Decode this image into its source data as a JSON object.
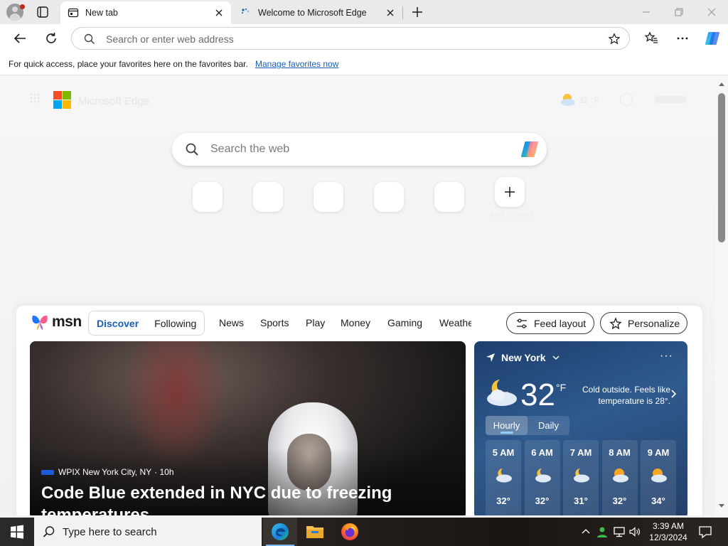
{
  "tabs": {
    "active": {
      "title": "New tab"
    },
    "inactive": {
      "title": "Welcome to Microsoft Edge"
    }
  },
  "addressbar": {
    "placeholder": "Search or enter web address",
    "value": ""
  },
  "favorites_bar": {
    "message": "For quick access, place your favorites here on the favorites bar.",
    "link": "Manage favorites now"
  },
  "ntp": {
    "search_placeholder": "Search the web",
    "brand_text": "Microsoft Edge",
    "weather_faded": "32 °F",
    "tiles_count": 6,
    "add_tile_label": "Add shortcut"
  },
  "feed": {
    "logo": "msn",
    "segments": [
      "Discover",
      "Following"
    ],
    "nav": [
      "News",
      "Sports",
      "Play",
      "Money",
      "Gaming",
      "Weathe"
    ],
    "feed_layout_label": "Feed layout",
    "personalize_label": "Personalize",
    "hero": {
      "source": "WPIX New York City, NY",
      "age": "· 10h",
      "headline": "Code Blue extended in NYC due to freezing temperatures"
    },
    "weather": {
      "location": "New York",
      "more": "···",
      "temp": "32",
      "unit": "°F",
      "description": "Cold outside. Feels like temperature is 28°.",
      "tabs": [
        "Hourly",
        "Daily"
      ],
      "hourly": [
        {
          "time": "5 AM",
          "temp": "32°",
          "icon": "partly-cloudy-night"
        },
        {
          "time": "6 AM",
          "temp": "32°",
          "icon": "partly-cloudy-night"
        },
        {
          "time": "7 AM",
          "temp": "31°",
          "icon": "partly-cloudy-night"
        },
        {
          "time": "8 AM",
          "temp": "32°",
          "icon": "partly-sunny"
        },
        {
          "time": "9 AM",
          "temp": "34°",
          "icon": "partly-sunny"
        }
      ]
    }
  },
  "taskbar": {
    "search_placeholder": "Type here to search",
    "apps": [
      "edge-icon",
      "file-explorer-icon",
      "firefox-icon"
    ],
    "time": "3:39 AM",
    "date": "12/3/2024"
  },
  "colors": {
    "accent": "#1a5fb4",
    "weather_bg": "#2f5a8e",
    "taskbar": "#1f1a17"
  }
}
